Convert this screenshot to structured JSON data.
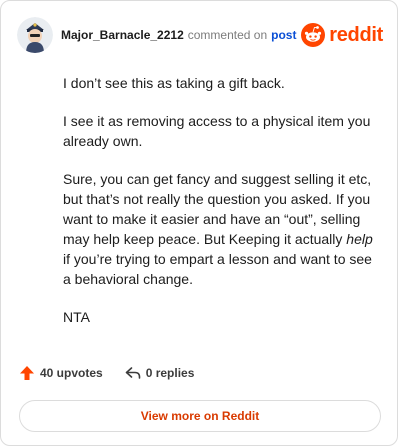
{
  "comment": {
    "username": "Major_Barnacle_2212",
    "action_text": "commented on",
    "post_link": "post",
    "brand_name": "reddit",
    "paragraphs": {
      "p1": "I don’t see this as taking a gift back.",
      "p2": "I see it as removing access to a physical item you already own.",
      "p3_a": "Sure, you can get fancy and suggest selling it etc, but that’s not really the question you asked. If you want to make it easier and have an “out”, selling may help keep peace. But Keeping it actually ",
      "p3_em": "help",
      "p3_b": " if you’re trying to empart a lesson and want to see a behavioral change.",
      "p4": "NTA"
    }
  },
  "stats": {
    "upvotes_label": "40 upvotes",
    "replies_label": "0 replies"
  },
  "footer": {
    "view_more_label": "View more on Reddit"
  },
  "colors": {
    "brand": "#ff4500",
    "link": "#0a4fd6",
    "view_more": "#d93a00"
  },
  "icons": {
    "upvote": "upvote-arrow-icon",
    "reply": "reply-arrow-icon",
    "brand": "reddit-snoo-icon"
  }
}
